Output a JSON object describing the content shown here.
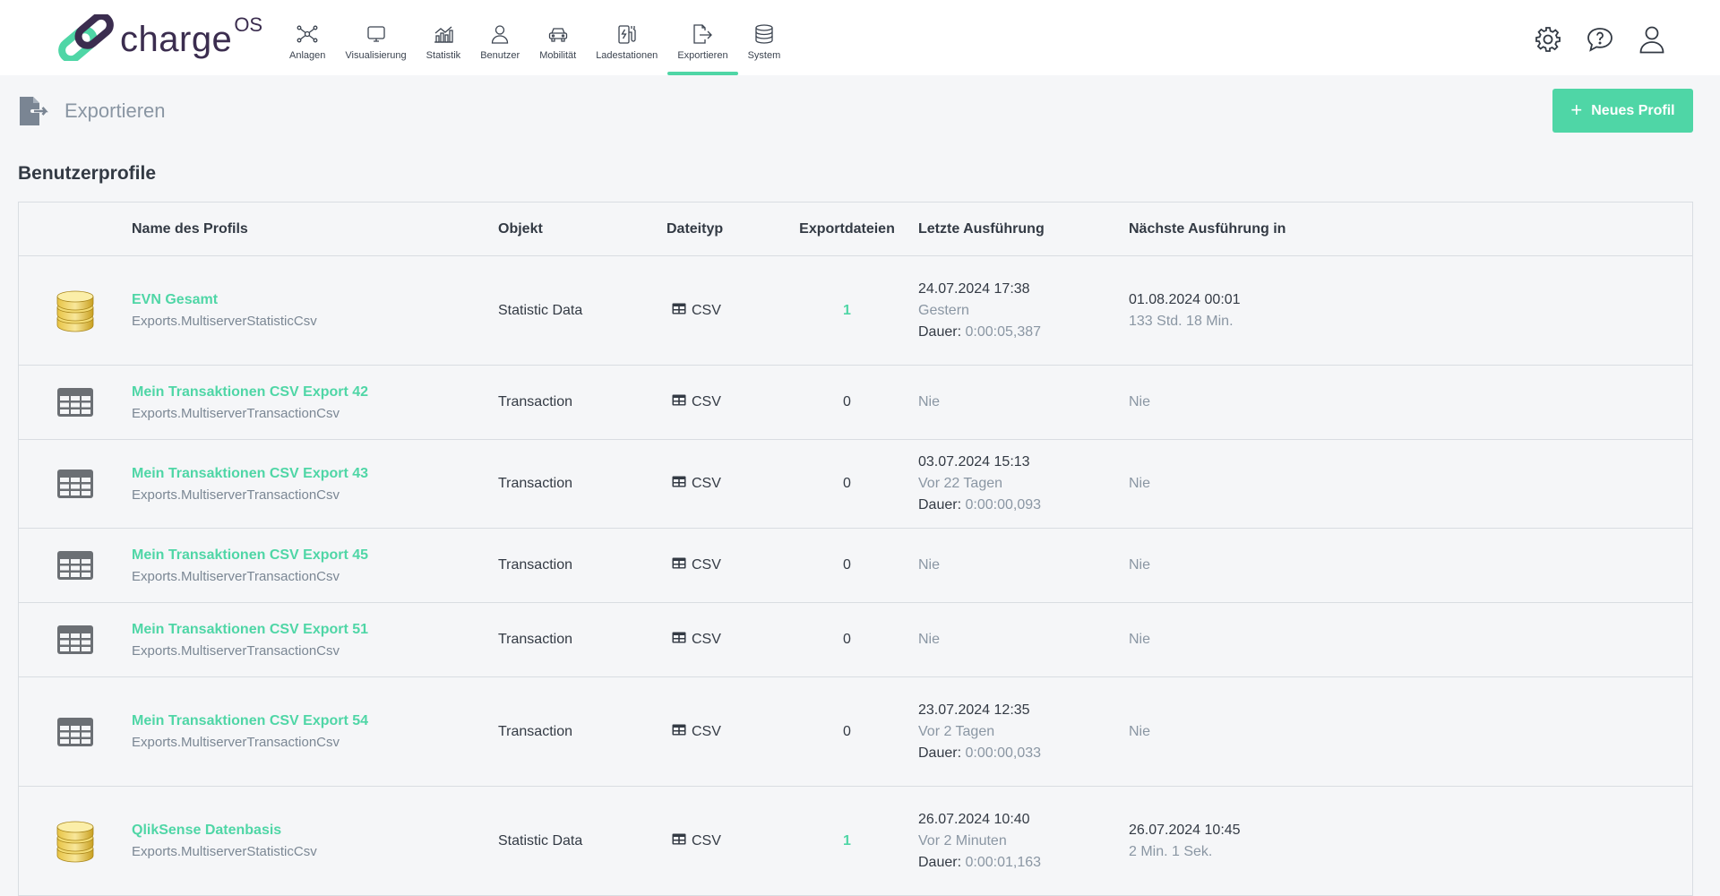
{
  "app": {
    "logo_text": "charge",
    "logo_sup": "OS"
  },
  "nav": [
    {
      "label": "Anlagen",
      "icon": "network-icon"
    },
    {
      "label": "Visualisierung",
      "icon": "monitor-icon"
    },
    {
      "label": "Statistik",
      "icon": "chart-icon"
    },
    {
      "label": "Benutzer",
      "icon": "user-icon"
    },
    {
      "label": "Mobilität",
      "icon": "car-icon"
    },
    {
      "label": "Ladestationen",
      "icon": "charging-station-icon"
    },
    {
      "label": "Exportieren",
      "icon": "export-icon",
      "active": true
    },
    {
      "label": "System",
      "icon": "database-icon"
    }
  ],
  "top_icons": [
    "gear-icon",
    "help-chat-icon",
    "user-account-icon"
  ],
  "page": {
    "title": "Exportieren",
    "new_button": "Neues Profil",
    "section_title": "Benutzerprofile"
  },
  "table": {
    "headers": {
      "name": "Name des Profils",
      "object": "Objekt",
      "filetype": "Dateityp",
      "files": "Exportdateien",
      "last": "Letzte Ausführung",
      "next": "Nächste Ausführung in"
    },
    "rows": [
      {
        "icon": "database-gold-icon",
        "name": "EVN Gesamt",
        "sub": "Exports.MultiserverStatisticCsv",
        "object": "Statistic Data",
        "filetype": "CSV",
        "files": "1",
        "last_date": "24.07.2024 17:38",
        "last_rel": "Gestern",
        "dur_label": "Dauer:",
        "dur_value": "0:00:05,387",
        "next_date": "01.08.2024 00:01",
        "next_rel": "133 Std. 18 Min."
      },
      {
        "icon": "table-grid-icon",
        "name": "Mein Transaktionen CSV Export 42",
        "sub": "Exports.MultiserverTransactionCsv",
        "object": "Transaction",
        "filetype": "CSV",
        "files": "0",
        "last_nie": "Nie",
        "next_nie": "Nie"
      },
      {
        "icon": "table-grid-icon",
        "name": "Mein Transaktionen CSV Export 43",
        "sub": "Exports.MultiserverTransactionCsv",
        "object": "Transaction",
        "filetype": "CSV",
        "files": "0",
        "last_date": "03.07.2024 15:13",
        "last_rel": "Vor 22 Tagen",
        "dur_label": "Dauer:",
        "dur_value": "0:00:00,093",
        "next_nie": "Nie"
      },
      {
        "icon": "table-grid-icon",
        "name": "Mein Transaktionen CSV Export 45",
        "sub": "Exports.MultiserverTransactionCsv",
        "object": "Transaction",
        "filetype": "CSV",
        "files": "0",
        "last_nie": "Nie",
        "next_nie": "Nie"
      },
      {
        "icon": "table-grid-icon",
        "name": "Mein Transaktionen CSV Export 51",
        "sub": "Exports.MultiserverTransactionCsv",
        "object": "Transaction",
        "filetype": "CSV",
        "files": "0",
        "last_nie": "Nie",
        "next_nie": "Nie"
      },
      {
        "icon": "table-grid-icon",
        "name": "Mein Transaktionen CSV Export 54",
        "sub": "Exports.MultiserverTransactionCsv",
        "object": "Transaction",
        "filetype": "CSV",
        "files": "0",
        "last_date": "23.07.2024 12:35",
        "last_rel": "Vor 2 Tagen",
        "dur_label": "Dauer:",
        "dur_value": "0:00:00,033",
        "next_nie": "Nie"
      },
      {
        "icon": "database-gold-icon",
        "name": "QlikSense Datenbasis",
        "sub": "Exports.MultiserverStatisticCsv",
        "object": "Statistic Data",
        "filetype": "CSV",
        "files": "1",
        "last_date": "26.07.2024 10:40",
        "last_rel": "Vor 2 Minuten",
        "dur_label": "Dauer:",
        "dur_value": "0:00:01,163",
        "next_date": "26.07.2024 10:45",
        "next_rel": "2 Min. 1 Sek."
      }
    ]
  },
  "colors": {
    "accent": "#4fd6a6",
    "text": "#333a44",
    "muted": "#8a96a3",
    "logo_dark": "#3b2d4f"
  }
}
